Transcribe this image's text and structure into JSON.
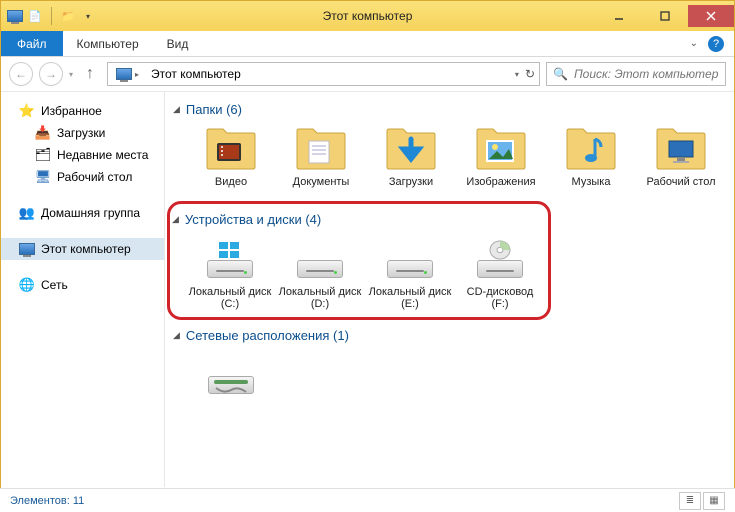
{
  "window": {
    "title": "Этот компьютер"
  },
  "ribbon": {
    "file": "Файл",
    "tabs": [
      "Компьютер",
      "Вид"
    ]
  },
  "address": {
    "crumb": "Этот компьютер"
  },
  "search": {
    "placeholder": "Поиск: Этот компьютер"
  },
  "sidebar": {
    "favorites": {
      "head": "Избранное",
      "items": [
        "Загрузки",
        "Недавние места",
        "Рабочий стол"
      ]
    },
    "homegroup": "Домашняя группа",
    "thispc": "Этот компьютер",
    "network": "Сеть"
  },
  "sections": {
    "folders": {
      "title": "Папки (6)",
      "items": [
        {
          "label": "Видео",
          "kind": "video"
        },
        {
          "label": "Документы",
          "kind": "docs"
        },
        {
          "label": "Загрузки",
          "kind": "downloads"
        },
        {
          "label": "Изображения",
          "kind": "pictures"
        },
        {
          "label": "Музыка",
          "kind": "music"
        },
        {
          "label": "Рабочий стол",
          "kind": "desktop"
        }
      ]
    },
    "drives": {
      "title": "Устройства и диски (4)",
      "items": [
        {
          "label": "Локальный диск (C:)",
          "kind": "win"
        },
        {
          "label": "Локальный диск (D:)",
          "kind": "hdd"
        },
        {
          "label": "Локальный диск (E:)",
          "kind": "hdd"
        },
        {
          "label": "CD-дисковод (F:)",
          "kind": "cd"
        }
      ]
    },
    "netloc": {
      "title": "Сетевые расположения (1)"
    }
  },
  "status": {
    "text": "Элементов: 11"
  }
}
